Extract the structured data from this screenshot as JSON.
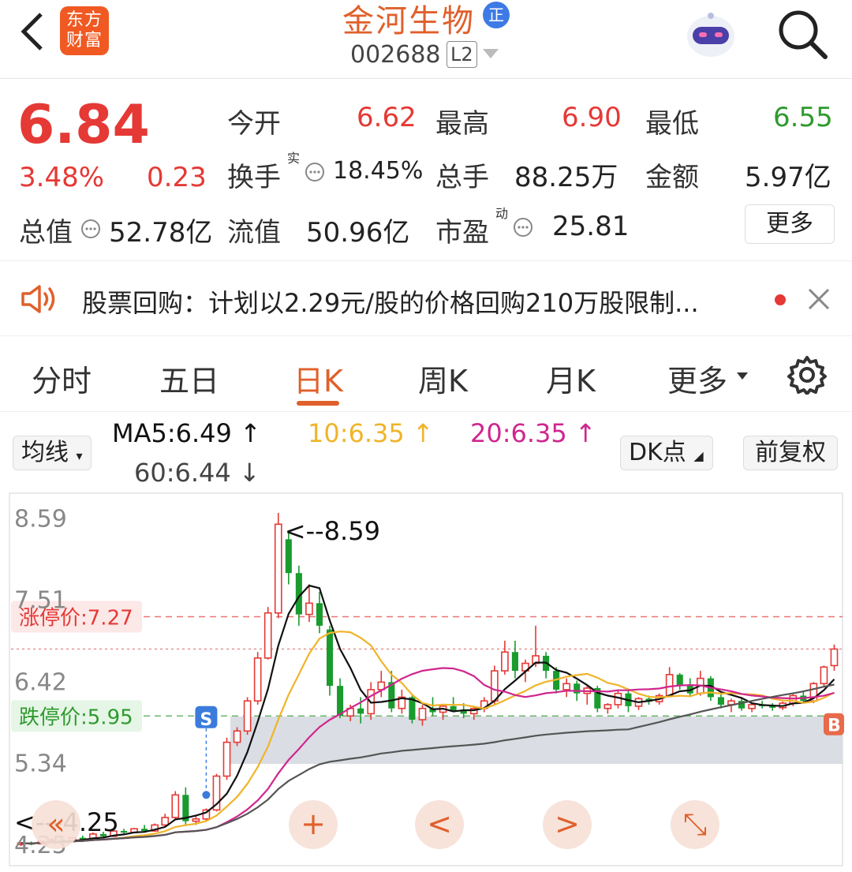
{
  "header": {
    "app_logo_text": "东方财富",
    "stock_name": "金河生物",
    "badge": "正",
    "stock_code": "002688",
    "level": "L2"
  },
  "quote": {
    "price": "6.84",
    "change_pct": "3.48%",
    "change": "0.23",
    "market_cap_label": "总值",
    "market_cap": "52.78亿",
    "fields": {
      "open_label": "今开",
      "open": "6.62",
      "high_label": "最高",
      "high": "6.90",
      "low_label": "最低",
      "low": "6.55",
      "turnover_label": "换手",
      "turnover_sup": "实",
      "turnover": "18.45%",
      "volume_label": "总手",
      "volume": "88.25万",
      "amount_label": "金额",
      "amount": "5.97亿",
      "float_label": "流值",
      "float": "50.96亿",
      "pe_label": "市盈",
      "pe_sup": "动",
      "pe": "25.81"
    },
    "more": "更多"
  },
  "notice": {
    "text": "股票回购：计划以2.29元/股的价格回购210万股限制..."
  },
  "tabs": [
    "分时",
    "五日",
    "日K",
    "周K",
    "月K",
    "更多"
  ],
  "active_tab": "日K",
  "ma": {
    "selector": "均线",
    "ma5": "MA5:6.49 ↑",
    "ma10": "10:6.35 ↑",
    "ma20": "20:6.35 ↑",
    "ma60": "60:6.44 ↓",
    "dk": "DK点",
    "adjust": "前复权"
  },
  "colors": {
    "up": "#e53935",
    "down": "#1a9b2e",
    "ma5": "#111111",
    "ma10": "#f0b429",
    "ma20": "#d0268f",
    "ma60": "#555555",
    "accent": "#e0602b"
  },
  "chart_data": {
    "type": "candlestick",
    "y_ticks": [
      "8.59",
      "7.51",
      "6.42",
      "5.34",
      "4.25"
    ],
    "ylim": [
      4.2,
      8.65
    ],
    "limit_up_label": "涨停价:7.27",
    "limit_up": 7.27,
    "limit_down_label": "跌停价:5.95",
    "limit_down": 5.95,
    "max_annotation": "<--8.59",
    "min_annotation": "<---4.25",
    "signal_S": "S",
    "signal_B": "B",
    "candles": [
      [
        4.24,
        4.27,
        4.22,
        4.26
      ],
      [
        4.26,
        4.28,
        4.23,
        4.25
      ],
      [
        4.25,
        4.3,
        4.24,
        4.28
      ],
      [
        4.28,
        4.32,
        4.26,
        4.3
      ],
      [
        4.3,
        4.33,
        4.27,
        4.28
      ],
      [
        4.28,
        4.34,
        4.27,
        4.33
      ],
      [
        4.33,
        4.36,
        4.3,
        4.32
      ],
      [
        4.32,
        4.4,
        4.31,
        4.38
      ],
      [
        4.38,
        4.41,
        4.33,
        4.35
      ],
      [
        4.35,
        4.43,
        4.34,
        4.42
      ],
      [
        4.42,
        4.45,
        4.38,
        4.4
      ],
      [
        4.4,
        4.46,
        4.39,
        4.45
      ],
      [
        4.45,
        4.5,
        4.4,
        4.42
      ],
      [
        4.42,
        4.52,
        4.41,
        4.5
      ],
      [
        4.5,
        4.65,
        4.48,
        4.6
      ],
      [
        4.6,
        4.95,
        4.58,
        4.9
      ],
      [
        4.9,
        5.0,
        4.5,
        4.55
      ],
      [
        4.55,
        4.62,
        4.5,
        4.58
      ],
      [
        4.58,
        4.72,
        4.55,
        4.7
      ],
      [
        4.7,
        5.18,
        4.68,
        5.15
      ],
      [
        5.15,
        5.66,
        5.1,
        5.6
      ],
      [
        5.6,
        5.8,
        5.55,
        5.75
      ],
      [
        5.75,
        6.2,
        5.7,
        6.15
      ],
      [
        6.15,
        6.8,
        6.1,
        6.72
      ],
      [
        6.72,
        7.4,
        6.7,
        7.32
      ],
      [
        7.32,
        8.65,
        7.25,
        8.5
      ],
      [
        8.3,
        8.4,
        7.7,
        7.85
      ],
      [
        7.85,
        7.95,
        7.15,
        7.3
      ],
      [
        7.3,
        7.7,
        7.2,
        7.45
      ],
      [
        7.45,
        7.6,
        7.05,
        7.15
      ],
      [
        7.1,
        7.15,
        6.22,
        6.35
      ],
      [
        6.35,
        6.45,
        5.92,
        5.95
      ],
      [
        5.95,
        6.1,
        5.88,
        6.05
      ],
      [
        6.05,
        6.2,
        5.85,
        5.98
      ],
      [
        5.98,
        6.4,
        5.9,
        6.3
      ],
      [
        6.3,
        6.55,
        6.2,
        6.4
      ],
      [
        6.4,
        6.55,
        6.0,
        6.05
      ],
      [
        6.05,
        6.3,
        5.98,
        6.2
      ],
      [
        6.2,
        6.22,
        5.85,
        5.9
      ],
      [
        5.9,
        6.1,
        5.82,
        6.05
      ],
      [
        6.05,
        6.2,
        5.95,
        6.0
      ],
      [
        6.0,
        6.1,
        5.9,
        6.08
      ],
      [
        6.08,
        6.2,
        6.0,
        6.02
      ],
      [
        6.02,
        6.12,
        5.92,
        5.98
      ],
      [
        5.98,
        6.08,
        5.9,
        6.05
      ],
      [
        6.05,
        6.2,
        6.0,
        6.15
      ],
      [
        6.15,
        6.62,
        6.1,
        6.55
      ],
      [
        6.55,
        6.95,
        6.5,
        6.8
      ],
      [
        6.8,
        6.95,
        6.45,
        6.55
      ],
      [
        6.55,
        6.7,
        6.4,
        6.65
      ],
      [
        6.65,
        7.15,
        6.6,
        6.75
      ],
      [
        6.75,
        6.8,
        6.45,
        6.55
      ],
      [
        6.55,
        6.6,
        6.25,
        6.3
      ],
      [
        6.3,
        6.45,
        6.2,
        6.38
      ],
      [
        6.38,
        6.42,
        6.15,
        6.25
      ],
      [
        6.25,
        6.35,
        6.1,
        6.32
      ],
      [
        6.32,
        6.35,
        6.0,
        6.05
      ],
      [
        6.05,
        6.12,
        5.98,
        6.1
      ],
      [
        6.1,
        6.3,
        6.05,
        6.25
      ],
      [
        6.25,
        6.3,
        6.0,
        6.08
      ],
      [
        6.08,
        6.2,
        6.03,
        6.18
      ],
      [
        6.18,
        6.22,
        6.1,
        6.14
      ],
      [
        6.14,
        6.25,
        6.1,
        6.22
      ],
      [
        6.22,
        6.6,
        6.2,
        6.5
      ],
      [
        6.5,
        6.52,
        6.3,
        6.35
      ],
      [
        6.35,
        6.45,
        6.2,
        6.25
      ],
      [
        6.25,
        6.55,
        6.22,
        6.45
      ],
      [
        6.45,
        6.48,
        6.15,
        6.2
      ],
      [
        6.2,
        6.25,
        6.05,
        6.1
      ],
      [
        6.1,
        6.18,
        6.0,
        6.15
      ],
      [
        6.15,
        6.2,
        6.02,
        6.05
      ],
      [
        6.05,
        6.12,
        6.0,
        6.1
      ],
      [
        6.1,
        6.15,
        6.05,
        6.08
      ],
      [
        6.08,
        6.12,
        6.02,
        6.06
      ],
      [
        6.06,
        6.14,
        6.03,
        6.12
      ],
      [
        6.12,
        6.25,
        6.08,
        6.22
      ],
      [
        6.22,
        6.28,
        6.12,
        6.15
      ],
      [
        6.15,
        6.4,
        6.12,
        6.38
      ],
      [
        6.38,
        6.62,
        6.35,
        6.6
      ],
      [
        6.62,
        6.9,
        6.55,
        6.84
      ]
    ]
  },
  "nav": [
    "«",
    "+",
    "<",
    ">",
    "⤡"
  ]
}
